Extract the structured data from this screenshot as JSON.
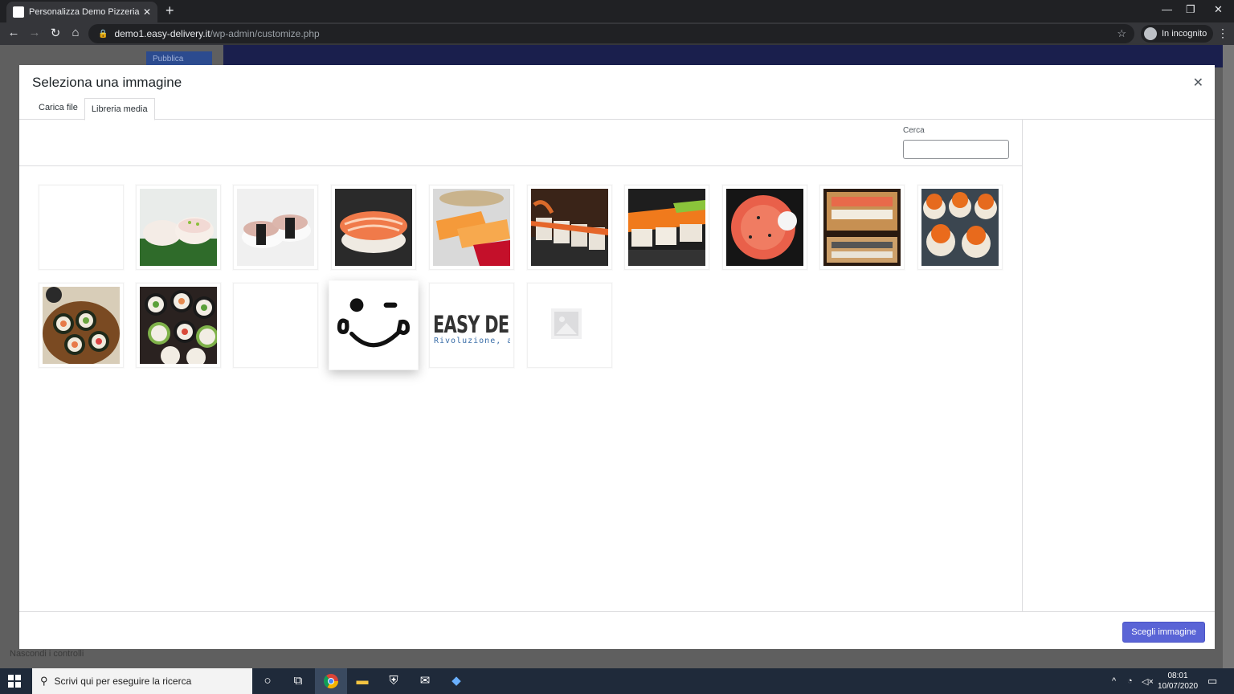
{
  "browser": {
    "tab_title": "Personalizza Demo Pizzeria Easy",
    "url_host": "demo1.easy-delivery.it",
    "url_path": "/wp-admin/customize.php",
    "incognito_label": "In incognito"
  },
  "background_page": {
    "publish_label": "Pubblica",
    "hide_controls_label": "Nascondi i controlli"
  },
  "modal": {
    "title": "Seleziona una immagine",
    "tabs": [
      {
        "label": "Carica file",
        "active": false
      },
      {
        "label": "Libreria media",
        "active": true
      }
    ],
    "search": {
      "label": "Cerca",
      "value": ""
    },
    "select_button": "Scegli immagine",
    "attachments": [
      {
        "name": "blank-1",
        "kind": "blank"
      },
      {
        "name": "sushi-nigiri-white-fish",
        "kind": "photo"
      },
      {
        "name": "sushi-octopus-nigiri",
        "kind": "photo"
      },
      {
        "name": "sushi-shrimp-nigiri",
        "kind": "photo"
      },
      {
        "name": "sushi-salmon-tuna-plate",
        "kind": "photo"
      },
      {
        "name": "sushi-dragon-roll",
        "kind": "photo"
      },
      {
        "name": "sushi-salmon-avocado-roll",
        "kind": "photo"
      },
      {
        "name": "sushi-salmon-temaki",
        "kind": "photo"
      },
      {
        "name": "sushi-tray-assorted",
        "kind": "photo"
      },
      {
        "name": "sushi-uramaki-tobiko",
        "kind": "photo"
      },
      {
        "name": "sushi-board-maki",
        "kind": "photo"
      },
      {
        "name": "sushi-futomaki-slate",
        "kind": "photo"
      },
      {
        "name": "blank-2",
        "kind": "blank"
      },
      {
        "name": "wink-face-logo",
        "kind": "logo"
      },
      {
        "name": "easy-delivery-logo",
        "kind": "text-logo",
        "logo_text": "EASY DEL",
        "logo_subtext": "Rivoluzione, a"
      },
      {
        "name": "image-placeholder",
        "kind": "placeholder"
      }
    ]
  },
  "taskbar": {
    "search_placeholder": "Scrivi qui per eseguire la ricerca",
    "time": "08:01",
    "date": "10/07/2020"
  },
  "colors": {
    "accent_button": "#5a64d6",
    "admin_bar": "#1a1f4d",
    "taskbar": "#1f2a3a"
  }
}
